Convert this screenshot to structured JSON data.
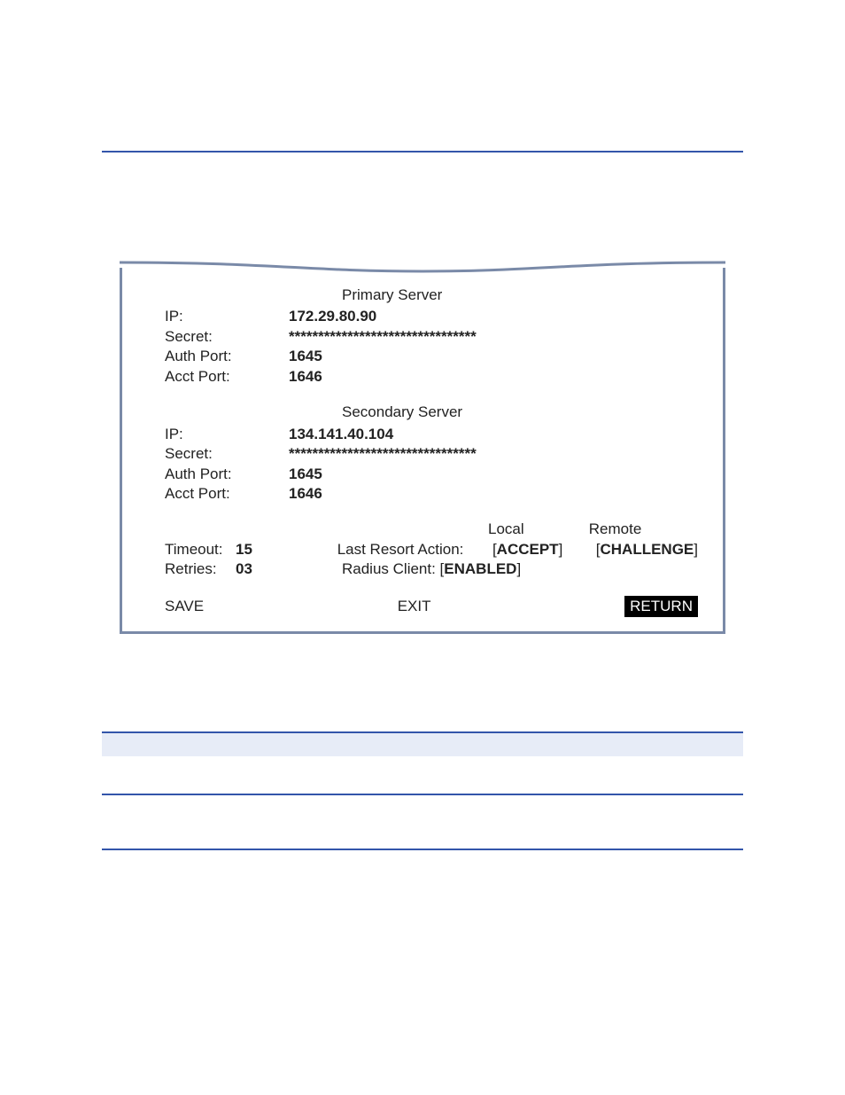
{
  "primary_server": {
    "heading": "Primary Server",
    "ip_label": "IP:",
    "ip_value": "172.29.80.90",
    "secret_label": "Secret:",
    "secret_value": "********************************",
    "auth_port_label": "Auth Port:",
    "auth_port_value": "1645",
    "acct_port_label": "Acct Port:",
    "acct_port_value": "1646"
  },
  "secondary_server": {
    "heading": "Secondary Server",
    "ip_label": "IP:",
    "ip_value": "134.141.40.104",
    "secret_label": "Secret:",
    "secret_value": "********************************",
    "auth_port_label": "Auth Port:",
    "auth_port_value": "1645",
    "acct_port_label": "Acct Port:",
    "acct_port_value": "1646"
  },
  "options": {
    "timeout_label": "Timeout:",
    "timeout_value": "15",
    "retries_label": "Retries:",
    "retries_value": "03",
    "col_local": "Local",
    "col_remote": "Remote",
    "lra_label": "Last Resort Action:",
    "lra_local": "ACCEPT",
    "lra_remote": "CHALLENGE",
    "radius_client_label": "Radius Client:",
    "radius_client_value": "ENABLED"
  },
  "footer": {
    "save": "SAVE",
    "exit": "EXIT",
    "return": "RETURN"
  }
}
